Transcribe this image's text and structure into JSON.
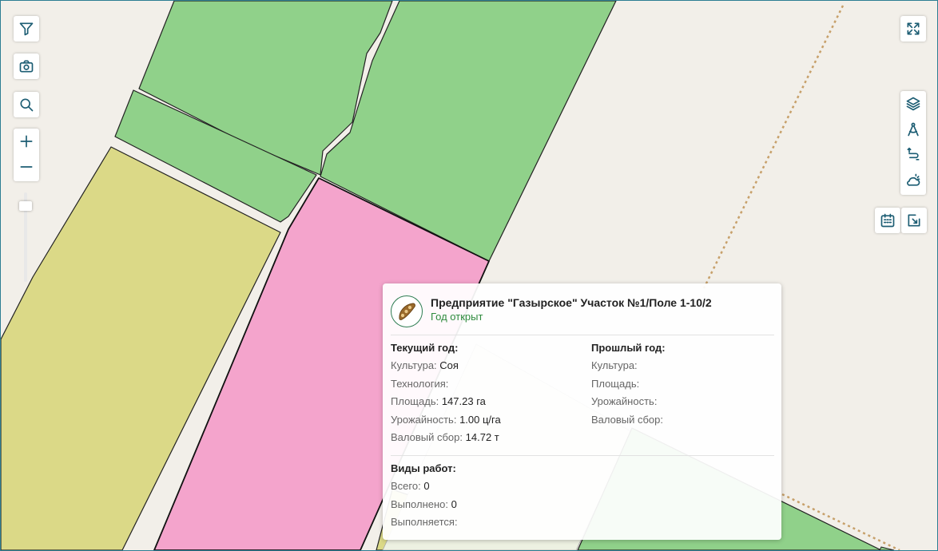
{
  "popup": {
    "title": "Предприятие \"Газырское\" Участок №1/Поле 1-10/2",
    "status": "Год открыт",
    "current": {
      "header": "Текущий год:",
      "rows": [
        {
          "label": "Культура:",
          "value": "Соя"
        },
        {
          "label": "Технология:",
          "value": ""
        },
        {
          "label": "Площадь:",
          "value": "147.23 га"
        },
        {
          "label": "Урожайность:",
          "value": "1.00 ц/га"
        },
        {
          "label": "Валовый сбор:",
          "value": "14.72 т"
        }
      ]
    },
    "previous": {
      "header": "Прошлый год:",
      "rows": [
        {
          "label": "Культура:",
          "value": ""
        },
        {
          "label": "Площадь:",
          "value": ""
        },
        {
          "label": "Урожайность:",
          "value": ""
        },
        {
          "label": "Валовый сбор:",
          "value": ""
        }
      ]
    },
    "works": {
      "header": "Виды работ:",
      "rows": [
        {
          "label": "Всего:",
          "value": "0"
        },
        {
          "label": "Выполнено:",
          "value": "0"
        },
        {
          "label": "Выполняется:",
          "value": ""
        }
      ]
    }
  },
  "zoom_level": 0.85,
  "icons": {
    "left_toolbar": [
      "filter-icon",
      "camera-icon",
      "search-icon",
      "zoom-in-icon",
      "zoom-out-icon"
    ],
    "right_toolbar": [
      "fullscreen-icon",
      "layers-icon",
      "measure-icon",
      "route-icon",
      "weather-icon",
      "calendar-icon",
      "export-icon",
      "soybean-icon"
    ]
  },
  "colors": {
    "green_field": "#90d18a",
    "yellow_field": "#dbd987",
    "pink_field": "#f4a4cc",
    "map_background": "#f2efe9",
    "accent": "#1c5d73",
    "status_green": "#2e8b3d"
  }
}
